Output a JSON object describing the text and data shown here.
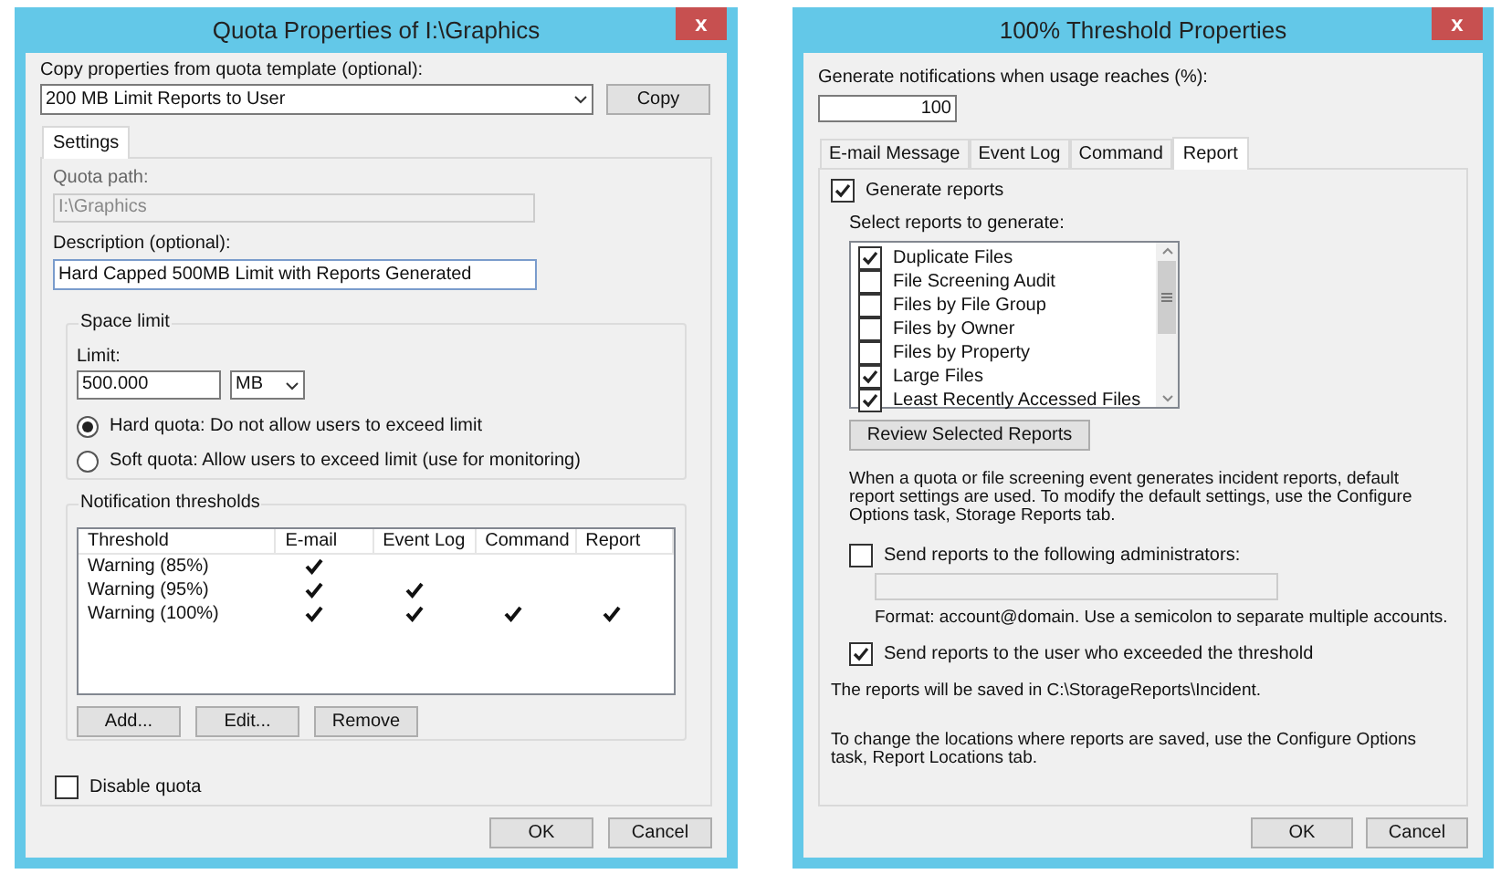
{
  "quota_dialog": {
    "title": "Quota Properties of I:\\Graphics",
    "close": "x",
    "template_label": "Copy properties from quota template (optional):",
    "template_value": "200 MB Limit Reports to User",
    "copy_button": "Copy",
    "tabs": [
      {
        "label": "Settings",
        "selected": true
      }
    ],
    "path_label": "Quota path:",
    "path_value": "I:\\Graphics",
    "description_label": "Description (optional):",
    "description_value": "Hard Capped 500MB Limit with Reports Generated",
    "space_limit": {
      "title": "Space limit",
      "limit_label": "Limit:",
      "limit_value": "500.000",
      "unit": "MB",
      "options": [
        {
          "label": "Hard quota: Do not allow users to exceed limit",
          "selected": true
        },
        {
          "label": "Soft quota: Allow users to exceed limit (use for monitoring)",
          "selected": false
        }
      ]
    },
    "thresholds": {
      "title": "Notification thresholds",
      "columns": [
        "Threshold",
        "E-mail",
        "Event Log",
        "Command",
        "Report"
      ],
      "rows": [
        {
          "threshold": "Warning (85%)",
          "email": true,
          "event_log": false,
          "command": false,
          "report": false
        },
        {
          "threshold": "Warning (95%)",
          "email": true,
          "event_log": true,
          "command": false,
          "report": false
        },
        {
          "threshold": "Warning (100%)",
          "email": true,
          "event_log": true,
          "command": true,
          "report": true
        }
      ],
      "buttons": [
        "Add...",
        "Edit...",
        "Remove"
      ]
    },
    "disable_quota": {
      "label": "Disable quota",
      "checked": false
    },
    "buttons": [
      "OK",
      "Cancel"
    ]
  },
  "threshold_dialog": {
    "title": "100% Threshold Properties",
    "close": "x",
    "usage_label": "Generate notifications when usage reaches (%):",
    "usage_value": "100",
    "tabs": [
      {
        "label": "E-mail Message",
        "selected": false
      },
      {
        "label": "Event Log",
        "selected": false
      },
      {
        "label": "Command",
        "selected": false
      },
      {
        "label": "Report",
        "selected": true
      }
    ],
    "generate_reports": {
      "label": "Generate reports",
      "checked": true
    },
    "select_label": "Select reports to generate:",
    "reports": [
      {
        "label": "Duplicate Files",
        "checked": true
      },
      {
        "label": "File Screening Audit",
        "checked": false
      },
      {
        "label": "Files by File Group",
        "checked": false
      },
      {
        "label": "Files by Owner",
        "checked": false
      },
      {
        "label": "Files by Property",
        "checked": false
      },
      {
        "label": "Large Files",
        "checked": true
      },
      {
        "label": "Least Recently Accessed Files",
        "checked": true
      }
    ],
    "review_button": "Review Selected Reports",
    "info_text": "When a quota or file screening event generates incident reports, default report settings are used. To modify the default settings, use the Configure Options task, Storage Reports tab.",
    "send_admins": {
      "label": "Send reports to the following administrators:",
      "checked": false
    },
    "format_text": "Format: account@domain. Use a semicolon to separate multiple accounts.",
    "send_user": {
      "label": "Send reports to the user who exceeded the threshold",
      "checked": true
    },
    "saved_text": "The reports will be saved in C:\\StorageReports\\Incident.",
    "change_text": "To change the locations where reports are saved, use the Configure Options task, Report Locations tab.",
    "buttons": [
      "OK",
      "Cancel"
    ]
  }
}
